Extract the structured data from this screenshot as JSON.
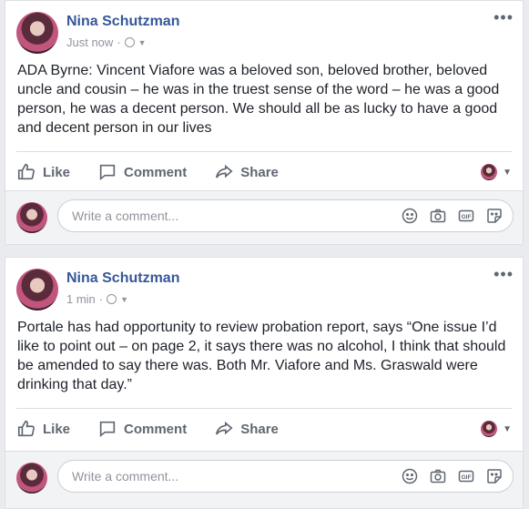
{
  "posts": [
    {
      "author": "Nina Schutzman",
      "timestamp": "Just now",
      "privacy_icon": "globe-icon",
      "text": "ADA Byrne: Vincent Viafore was a beloved son, beloved brother, beloved uncle and cousin – he was in the truest sense of the word – he was a good person, he was a decent person. We should all be as lucky to have a good and decent person in our lives",
      "actions": {
        "like": "Like",
        "comment": "Comment",
        "share": "Share"
      },
      "comment_placeholder": "Write a comment..."
    },
    {
      "author": "Nina Schutzman",
      "timestamp": "1 min",
      "privacy_icon": "globe-icon",
      "text": "Portale has had opportunity to review probation report, says “One issue I’d like to point out – on page 2, it says there was no alcohol, I think that should be amended to say there was. Both Mr. Viafore and Ms. Graswald were drinking that day.”",
      "actions": {
        "like": "Like",
        "comment": "Comment",
        "share": "Share"
      },
      "comment_placeholder": "Write a comment..."
    }
  ],
  "colors": {
    "author_link": "#365899",
    "meta_gray": "#90949c",
    "action_gray": "#606770",
    "feed_background": "#e9ebee"
  },
  "icons": [
    "more-options-icon",
    "globe-icon",
    "like-icon",
    "comment-icon",
    "share-icon",
    "emoji-icon",
    "camera-icon",
    "gif-icon",
    "sticker-icon"
  ]
}
